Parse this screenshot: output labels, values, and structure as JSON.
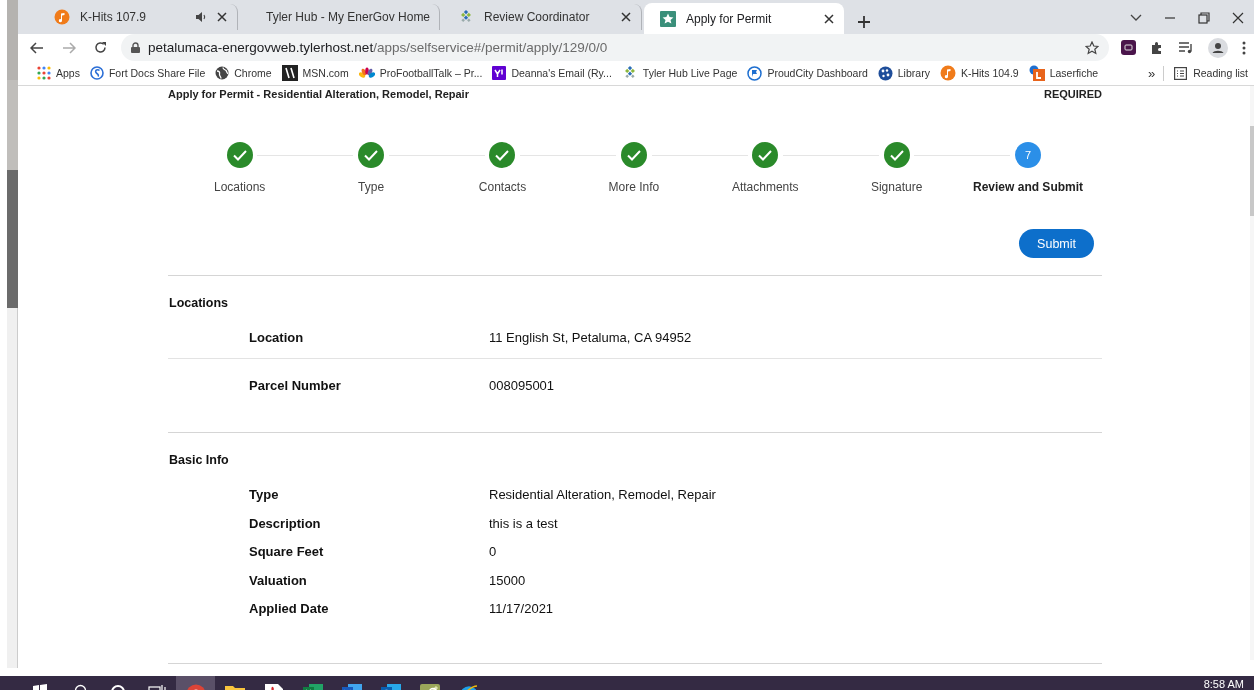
{
  "tabs": [
    {
      "title": "K-Hits 107.9",
      "kind": "radio",
      "audio": true,
      "selected": false
    },
    {
      "title": "Tyler Hub - My EnerGov Home",
      "kind": "tyler",
      "audio": false,
      "selected": false
    },
    {
      "title": "Review Coordinator",
      "kind": "tyler",
      "audio": false,
      "selected": false
    },
    {
      "title": "Apply for Permit",
      "kind": "star",
      "audio": false,
      "selected": true
    }
  ],
  "address_bar": {
    "host": "petalumaca-energovweb.tylerhost.net",
    "path": "/apps/selfservice#/permit/apply/129/0/0"
  },
  "bookmarks": [
    {
      "label": "Apps",
      "kind": "apps"
    },
    {
      "label": "Fort Docs Share File",
      "kind": "sharefile"
    },
    {
      "label": "Chrome",
      "kind": "globe"
    },
    {
      "label": "MSN.com",
      "kind": "msn"
    },
    {
      "label": "ProFootballTalk – Pr...",
      "kind": "peacock"
    },
    {
      "label": "Deanna's Email (Ry...",
      "kind": "yahoo"
    },
    {
      "label": "Tyler Hub Live Page",
      "kind": "tyler"
    },
    {
      "label": "ProudCity Dashboard",
      "kind": "flag"
    },
    {
      "label": "Library",
      "kind": "library"
    },
    {
      "label": "K-Hits 104.9",
      "kind": "radio"
    },
    {
      "label": "Laserfiche",
      "kind": "laserfiche"
    }
  ],
  "bookmarks_more": "»",
  "reading_list": "Reading list",
  "page": {
    "title": "Apply for Permit - Residential Alteration, Remodel, Repair",
    "required": "REQUIRED",
    "steps": [
      {
        "label": "Locations",
        "complete": true,
        "selected": false
      },
      {
        "label": "Type",
        "complete": true,
        "selected": false
      },
      {
        "label": "Contacts",
        "complete": true,
        "selected": false
      },
      {
        "label": "More Info",
        "complete": true,
        "selected": false
      },
      {
        "label": "Attachments",
        "complete": true,
        "selected": false
      },
      {
        "label": "Signature",
        "complete": true,
        "selected": false
      },
      {
        "label": "Review and Submit",
        "complete": false,
        "number": "7",
        "selected": true
      }
    ],
    "submit": "Submit",
    "sections": [
      {
        "heading": "Locations",
        "kind": "spaced",
        "rows": [
          {
            "label": "Location",
            "value": "11 English St, Petaluma, CA 94952"
          },
          {
            "label": "Parcel Number",
            "value": "008095001"
          }
        ]
      },
      {
        "heading": "Basic Info",
        "kind": "compact",
        "rows": [
          {
            "label": "Type",
            "value": "Residential Alteration, Remodel, Repair"
          },
          {
            "label": "Description",
            "value": "this is a test"
          },
          {
            "label": "Square Feet",
            "value": "0"
          },
          {
            "label": "Valuation",
            "value": "15000"
          },
          {
            "label": "Applied Date",
            "value": "11/17/2021"
          }
        ]
      }
    ]
  },
  "taskbar": {
    "apps": [
      {
        "kind": "start",
        "active": false
      },
      {
        "kind": "search",
        "active": false
      },
      {
        "kind": "cortana",
        "active": false
      },
      {
        "kind": "taskview",
        "active": false
      },
      {
        "kind": "chrome",
        "active": true
      },
      {
        "kind": "explorer",
        "active": false
      },
      {
        "kind": "acrobat",
        "active": false
      },
      {
        "kind": "excel",
        "active": false
      },
      {
        "kind": "word",
        "active": false
      },
      {
        "kind": "outlook",
        "active": false
      },
      {
        "kind": "energov",
        "active": false
      },
      {
        "kind": "ie",
        "active": false
      }
    ],
    "time": "8:58 AM"
  }
}
